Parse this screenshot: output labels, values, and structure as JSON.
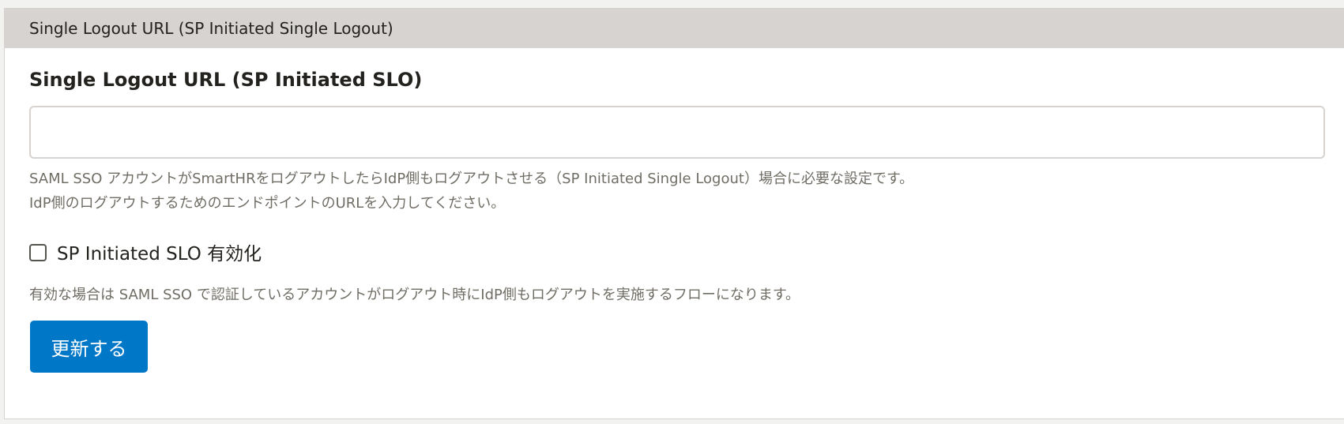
{
  "panel": {
    "header_title": "Single Logout URL (SP Initiated Single Logout)"
  },
  "form": {
    "field_label": "Single Logout URL (SP Initiated SLO)",
    "url_value": "",
    "help_line_1": "SAML SSO アカウントがSmartHRをログアウトしたらIdP側もログアウトさせる（SP Initiated Single Logout）場合に必要な設定です。",
    "help_line_2": "IdP側のログアウトするためのエンドポイントのURLを入力してください。",
    "checkbox_label": "SP Initiated SLO 有効化",
    "checkbox_checked": false,
    "checkbox_description": "有効な場合は SAML SSO で認証しているアカウントがログアウト時にIdP側もログアウトを実施するフローになります。",
    "submit_label": "更新する"
  },
  "colors": {
    "header_bg": "#d6d3d0",
    "primary_button": "#0077c7",
    "text": "#23221e",
    "muted_text": "#706d65",
    "input_border": "#d6d3d0"
  }
}
